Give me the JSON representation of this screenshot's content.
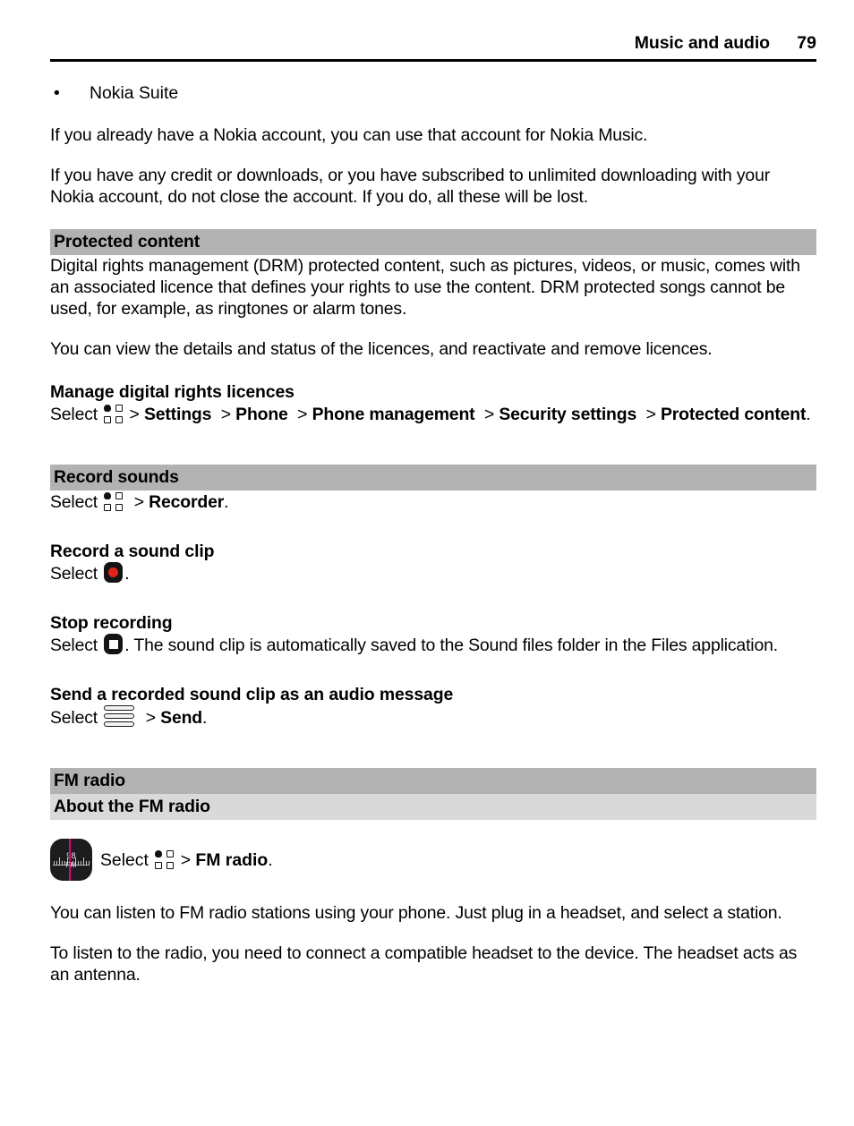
{
  "header": {
    "title": "Music and audio",
    "page_number": "79"
  },
  "bullets": [
    {
      "marker": "•",
      "text": "Nokia Suite"
    }
  ],
  "paragraphs": {
    "nokia_account": "If you already have a Nokia account, you can use that account for Nokia Music.",
    "credit_downloads": "If you have any credit or downloads, or you have subscribed to unlimited downloading with your Nokia account, do not close the account. If you do, all these will be lost.",
    "drm_intro": "Digital rights management (DRM) protected content, such as pictures, videos, or music, comes with an associated licence that defines your rights to use the content. DRM protected songs cannot be used, for example, as ringtones or alarm tones.",
    "drm_view": "You can view the details and status of the licences, and reactivate and remove licences.",
    "fm_listen": "You can listen to FM radio stations using your phone. Just plug in a headset, and select a station.",
    "fm_headset": "To listen to the radio, you need to connect a compatible headset to the device. The headset acts as an antenna."
  },
  "sections": {
    "protected_content": {
      "band_title": "Protected content",
      "task_title": "Manage digital rights licences",
      "select_label": "Select",
      "menu_icon": "menu-grid-icon",
      "path": [
        {
          "sep": ">",
          "label": "Settings"
        },
        {
          "sep": ">",
          "label": "Phone"
        },
        {
          "sep": ">",
          "label": "Phone management"
        },
        {
          "sep": ">",
          "label": "Security settings"
        },
        {
          "sep": ">",
          "label": "Protected content"
        }
      ],
      "path_terminator": "."
    },
    "record_sounds": {
      "band_title": "Record sounds",
      "select_label": "Select",
      "menu_icon": "menu-grid-icon",
      "separator": ">",
      "app_name": "Recorder",
      "terminator": ".",
      "record_clip": {
        "title": "Record a sound clip",
        "select_label": "Select",
        "icon": "record-button-icon",
        "terminator": "."
      },
      "stop_recording": {
        "title": "Stop recording",
        "select_label": "Select",
        "icon": "stop-button-icon",
        "after_icon_text": ". The sound clip is automatically saved to the Sound files folder in the Files application."
      },
      "send_clip": {
        "title": "Send a recorded sound clip as an audio message",
        "select_label": "Select",
        "icon": "options-list-icon",
        "separator": ">",
        "command": "Send",
        "terminator": "."
      }
    },
    "fm_radio": {
      "band_title": "FM radio",
      "subband_title": "About the FM radio",
      "app_icon": {
        "name": "fm-radio-app-icon",
        "frequency": "98",
        "label": "FM",
        "needle_color": "#e6007e",
        "background_color": "#1d1d1f"
      },
      "select_label": "Select",
      "menu_icon": "menu-grid-icon",
      "separator": ">",
      "app_name": "FM radio",
      "terminator": "."
    }
  },
  "colors": {
    "band_dark": "#b2b2b2",
    "band_light": "#d9d9d9",
    "record_red": "#e2231a",
    "text": "#000000",
    "page_background": "#ffffff"
  }
}
